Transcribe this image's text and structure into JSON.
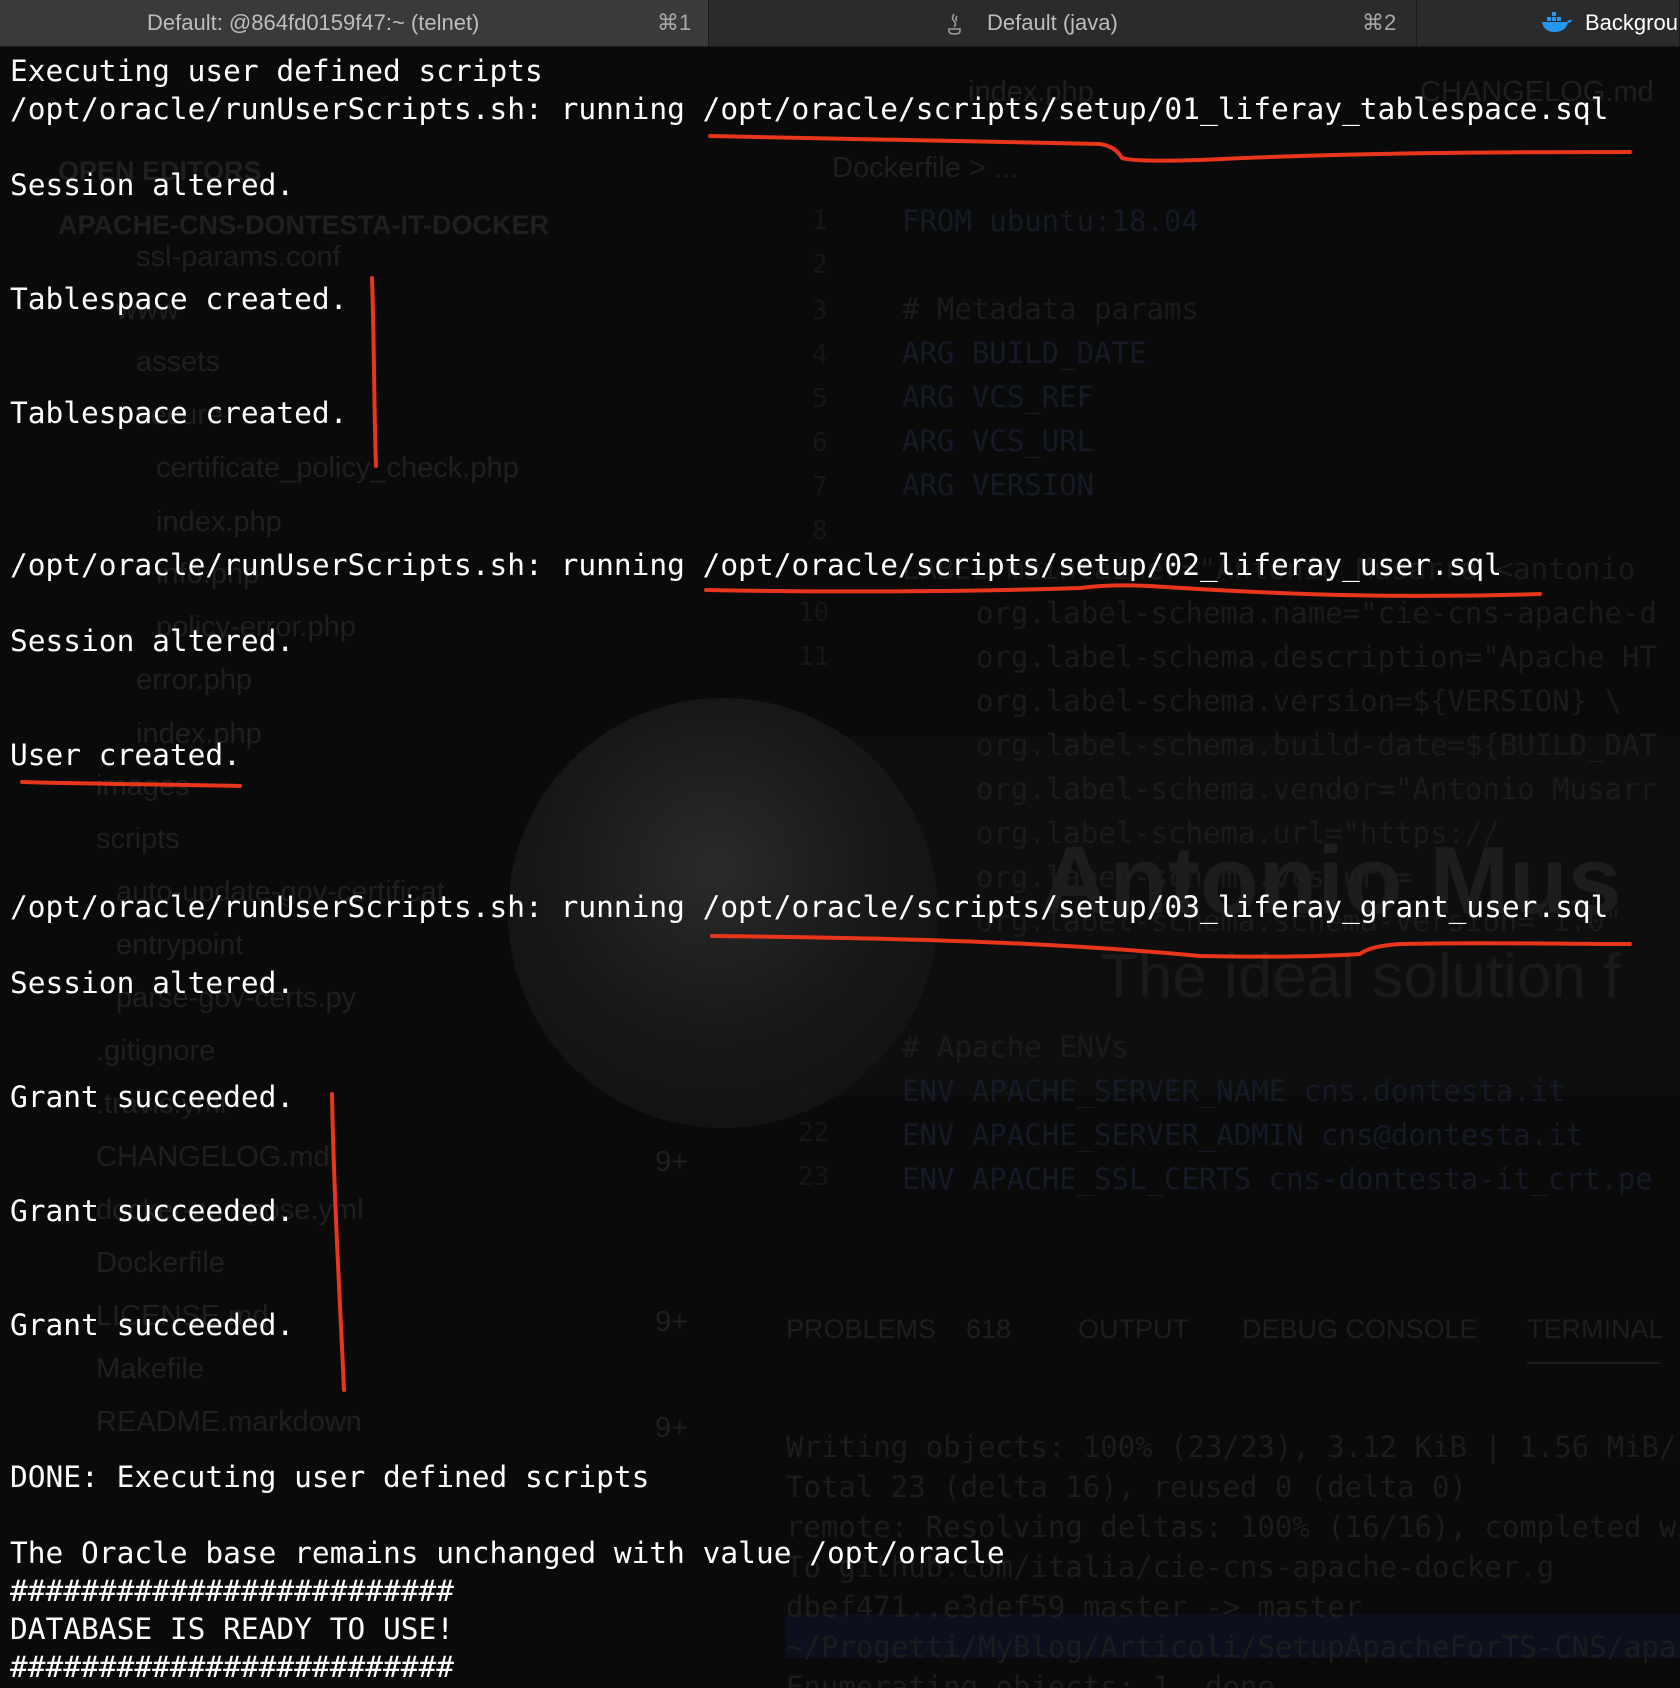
{
  "tabs": [
    {
      "title": "Default: @864fd0159f47:~ (telnet)",
      "shortcut": "⌘1"
    },
    {
      "title": "Default (java)",
      "shortcut": "⌘2",
      "icon": "java-icon"
    },
    {
      "title": "Backgrou",
      "icon": "docker-icon"
    }
  ],
  "terminal": {
    "lines": [
      "Executing user defined scripts",
      "/opt/oracle/runUserScripts.sh: running /opt/oracle/scripts/setup/01_liferay_tablespace.sql",
      "Session altered.",
      "Tablespace created.",
      "Tablespace created.",
      "/opt/oracle/runUserScripts.sh: running /opt/oracle/scripts/setup/02_liferay_user.sql",
      "Session altered.",
      "User created.",
      "/opt/oracle/runUserScripts.sh: running /opt/oracle/scripts/setup/03_liferay_grant_user.sql",
      "Session altered.",
      "Grant succeeded.",
      "Grant succeeded.",
      "Grant succeeded.",
      "DONE: Executing user defined scripts",
      "The Oracle base remains unchanged with value /opt/oracle",
      "#########################",
      "DATABASE IS READY TO USE!",
      "#########################"
    ]
  },
  "background_editor": {
    "sidebar": {
      "section_open_editors": "OPEN EDITORS",
      "section_project": "APACHE-CNS-DONTESTA-IT-DOCKER",
      "items": [
        "ssl-params.conf",
        "www",
        "assets",
        "secure",
        "certificate_policy_check.php",
        "index.php",
        "info.php",
        "policy-error.php",
        "error.php",
        "index.php",
        "images",
        "scripts",
        "auto-update-gov-certificat",
        "entrypoint",
        "parse-gov-certs.py",
        ".gitignore",
        ".travis.yml",
        "CHANGELOG.md",
        "docker-compose.yml",
        "Dockerfile",
        "LICENSE.md",
        "Makefile",
        "README.markdown"
      ],
      "badges": [
        "9+",
        "9+",
        "9+"
      ]
    },
    "editor_tabs": [
      "index.php",
      "CHANGELOG.md"
    ],
    "breadcrumb": "Dockerfile > ...",
    "line_numbers": [
      "1",
      "2",
      "3",
      "4",
      "5",
      "6",
      "7",
      "8",
      "10",
      "11",
      "21",
      "22",
      "23"
    ],
    "code_lines": [
      "FROM ubuntu:18.04",
      "# Metadata params",
      "ARG BUILD_DATE",
      "ARG VCS_REF",
      "ARG VCS_URL",
      "ARG VERSION",
      "LABEL maintainer=\"Antonio Musarra <antonio",
      "org.label-schema.name=\"cie-cns-apache-d",
      "org.label-schema.description=\"Apache HT",
      "org.label-schema.version=${VERSION} \\",
      "org.label-schema.build-date=${BUILD_DAT",
      "org.label-schema.vendor=\"Antonio Musarr",
      "org.label-schema.url=\"https://",
      "org.label-schema.vcs-url=",
      "org.label-schema.schema-version=\"1.0\"",
      "# Apache ENVs",
      "ENV APACHE_SERVER_NAME cns.dontesta.it",
      "ENV APACHE_SERVER_ADMIN cns@dontesta.it",
      "ENV APACHE_SSL_CERTS cns-dontesta-it_crt.pe"
    ],
    "panel_tabs": [
      "PROBLEMS",
      "618",
      "OUTPUT",
      "DEBUG CONSOLE",
      "TERMINAL"
    ],
    "terminal_lines": [
      "Writing objects: 100% (23/23), 3.12 KiB | 1.56 MiB/s",
      "Total 23 (delta 16), reused 0 (delta 0)",
      "remote: Resolving deltas: 100% (16/16), completed wi",
      "To github.com/italia/cie-cns-apache-docker.g",
      "   dbef471..e3def59  master -> master",
      "~/Progetti/MyBlog/Articoli/SetupApacheForTS-CNS/apa",
      "Enumerating objects: 1, done."
    ],
    "wallpaper_brand": "Antonio Mus",
    "wallpaper_tagline": "The ideal solution f"
  },
  "colors": {
    "terminal_background": "#0a0a0a",
    "terminal_text": "#ffffff",
    "annotation_red": "#e8351c",
    "tabbar_active": "#3a3a3c",
    "tabbar_inactive": "#2b2b2d"
  }
}
